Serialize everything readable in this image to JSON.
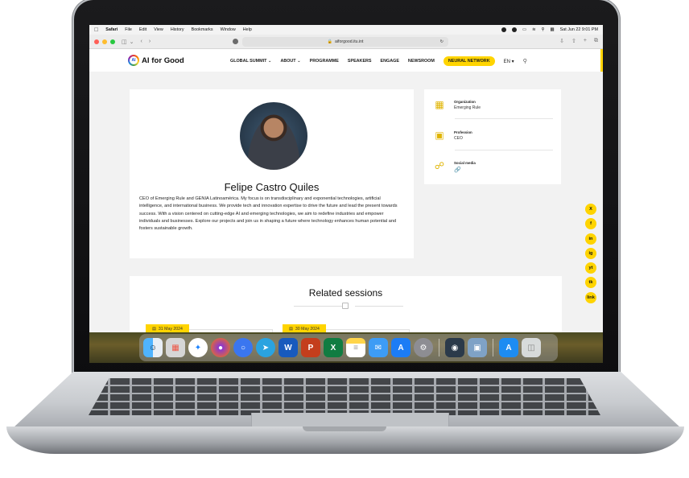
{
  "menubar": {
    "app_name": "Safari",
    "menus": [
      "File",
      "Edit",
      "View",
      "History",
      "Bookmarks",
      "Window",
      "Help"
    ],
    "clock": "Sat Jun 22  9:01 PM"
  },
  "browser": {
    "url": "aiforgood.itu.int",
    "lock_icon": "lock-icon",
    "window_controls": {
      "close": "#ff5f57",
      "minimize": "#febc2e",
      "zoom": "#28c840"
    }
  },
  "site": {
    "logo_mark": "AI",
    "logo_text": "AI for Good",
    "nav": [
      {
        "label": "GLOBAL SUMMIT",
        "dropdown": true
      },
      {
        "label": "ABOUT",
        "dropdown": true
      },
      {
        "label": "PROGRAMME"
      },
      {
        "label": "SPEAKERS"
      },
      {
        "label": "ENGAGE"
      },
      {
        "label": "NEWSROOM"
      }
    ],
    "nav_highlight": "NEURAL NETWORK",
    "language": "EN",
    "accent_color": "#ffd400"
  },
  "profile": {
    "name": "Felipe Castro Quiles",
    "bio": "CEO of Emerging Rule and GENIA Latinoamérica. My focus is on transdisciplinary and exponential technologies, artificial intelligence, and international business. We provide tech and innovation expertise to drive the future and lead the present towards success. With a vision centered on cutting-edge AI and emerging technologies, we aim to redefine industries and empower individuals and businesses. Explore our projects and join us in shaping a future where technology enhances human potential and fosters sustainable growth."
  },
  "details": {
    "organization_label": "Organization",
    "organization_value": "Emerging Rule",
    "profession_label": "Profession",
    "profession_value": "CEO",
    "social_label": "Social media",
    "social_icon": "link-icon"
  },
  "social_buttons": [
    "X",
    "f",
    "in",
    "ig",
    "yt",
    "tk",
    "link"
  ],
  "related": {
    "title": "Related sessions",
    "dates": [
      "31 May 2024",
      "30 May 2024"
    ]
  },
  "dock": {
    "apps": [
      "finder",
      "launchpad",
      "safari",
      "firefox",
      "signal",
      "telegram",
      "word",
      "powerpoint",
      "excel",
      "notes",
      "mail",
      "app-store-dev",
      "system-settings",
      "preview",
      "image-capture",
      "app-store",
      "trash"
    ]
  }
}
